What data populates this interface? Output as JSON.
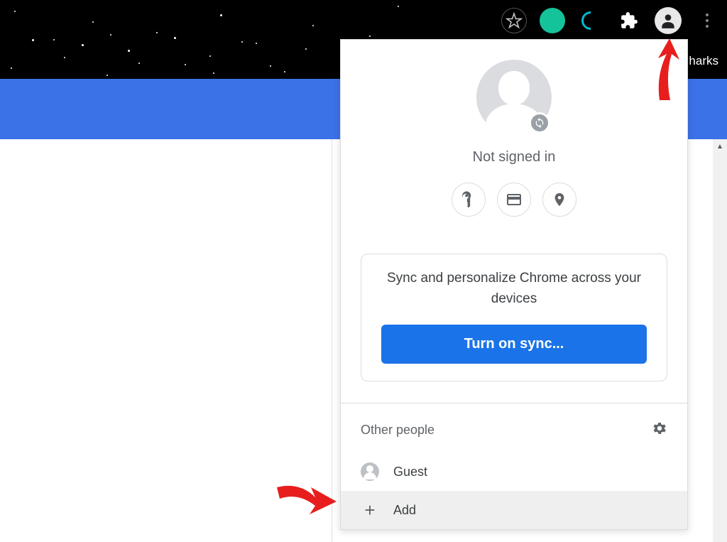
{
  "toolbar": {
    "bookmarks_hint": "harks"
  },
  "profile_menu": {
    "status": "Not signed in",
    "sync_card": {
      "description": "Sync and personalize Chrome across your devices",
      "button": "Turn on sync..."
    },
    "other_people": {
      "title": "Other people",
      "items": [
        {
          "label": "Guest",
          "icon": "guest"
        },
        {
          "label": "Add",
          "icon": "plus"
        }
      ]
    }
  }
}
